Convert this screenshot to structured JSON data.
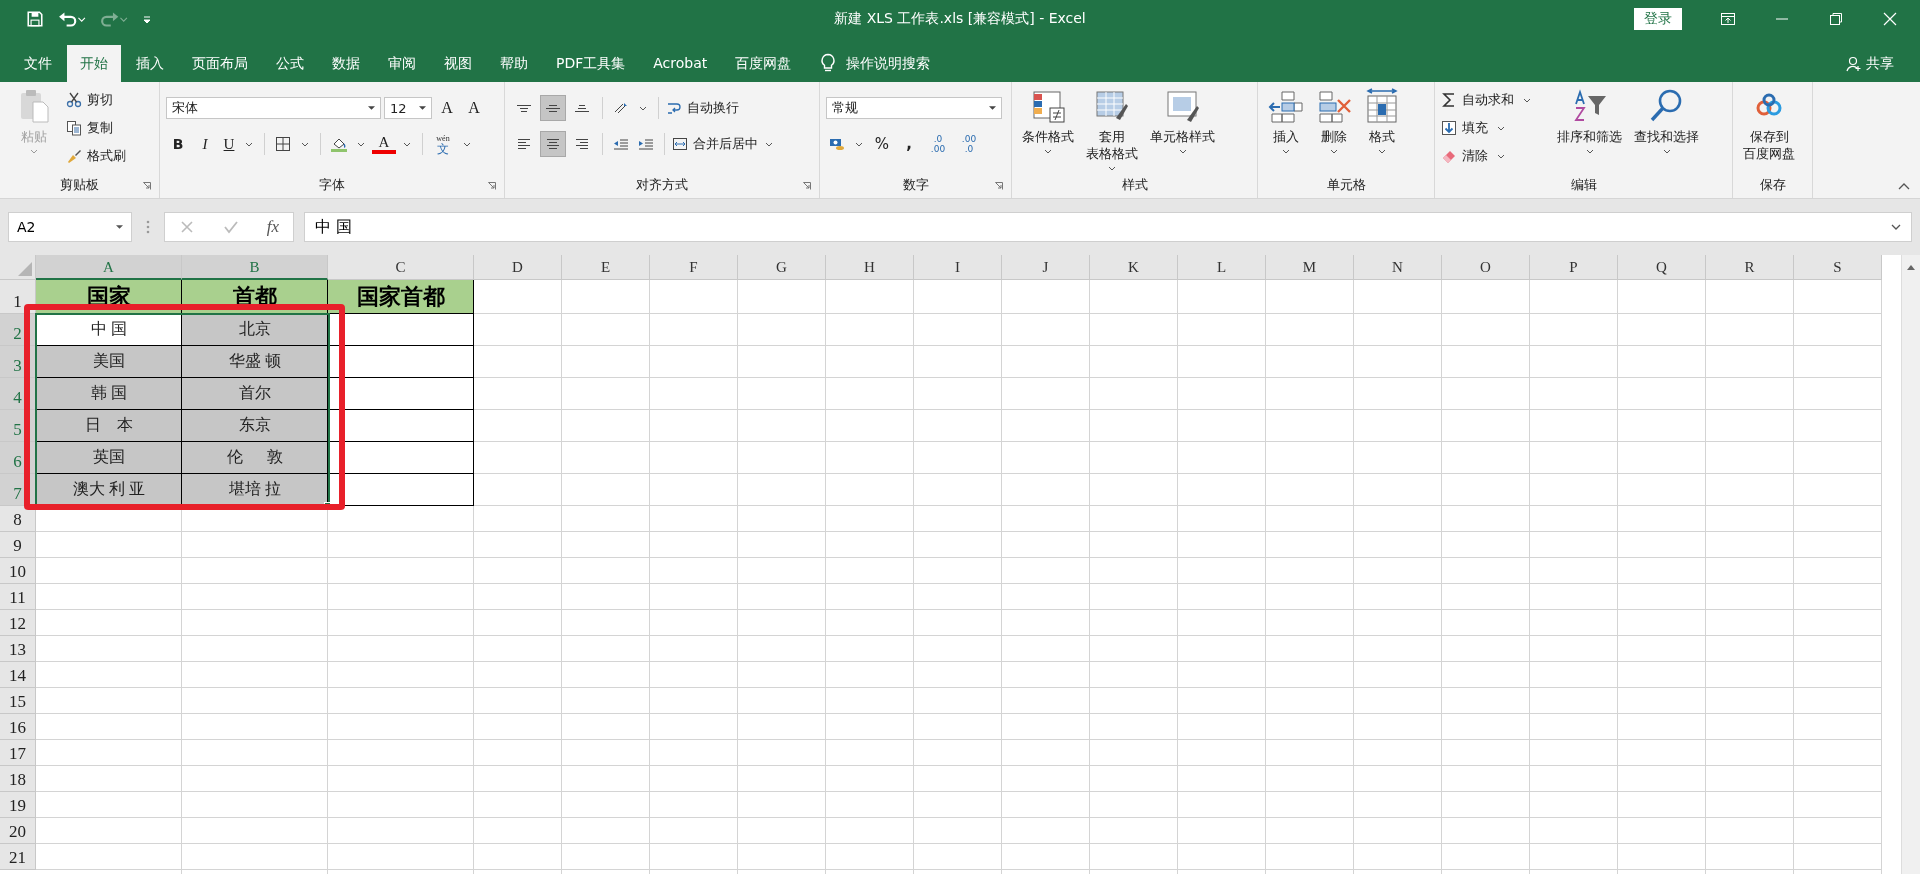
{
  "title_bar": {
    "title": "新建 XLS 工作表.xls  [兼容模式]  -  Excel",
    "login": "登录"
  },
  "tabs": [
    {
      "label": "文件",
      "selected": false
    },
    {
      "label": "开始",
      "selected": true
    },
    {
      "label": "插入",
      "selected": false
    },
    {
      "label": "页面布局",
      "selected": false
    },
    {
      "label": "公式",
      "selected": false
    },
    {
      "label": "数据",
      "selected": false
    },
    {
      "label": "审阅",
      "selected": false
    },
    {
      "label": "视图",
      "selected": false
    },
    {
      "label": "帮助",
      "selected": false
    },
    {
      "label": "PDF工具集",
      "selected": false
    },
    {
      "label": "Acrobat",
      "selected": false
    },
    {
      "label": "百度网盘",
      "selected": false
    }
  ],
  "tell_me": "操作说明搜索",
  "share": "共享",
  "clipboard": {
    "label": "剪贴板",
    "paste": {
      "label": "粘贴",
      "disabled": true
    },
    "items": [
      {
        "label": "剪切",
        "kind": "cut"
      },
      {
        "label": "复制",
        "kind": "copy"
      },
      {
        "label": "格式刷",
        "kind": "painter"
      }
    ]
  },
  "font": {
    "label": "字体",
    "name": "宋体",
    "size": "12",
    "grow": "A",
    "shrink": "A",
    "bold": "B",
    "italic": "I",
    "underline": "U",
    "color_letter": "A",
    "phonetic": "文",
    "phonetic_top": "wén"
  },
  "alignment": {
    "label": "对齐方式",
    "vertical": [
      {
        "kind": "top",
        "selected": false
      },
      {
        "kind": "middle",
        "selected": true
      },
      {
        "kind": "bottom",
        "selected": false
      }
    ],
    "horizontal": [
      {
        "kind": "left",
        "selected": false
      },
      {
        "kind": "center",
        "selected": true
      },
      {
        "kind": "right",
        "selected": false
      }
    ],
    "wrap": "自动换行",
    "merge": "合并后居中"
  },
  "number": {
    "label": "数字",
    "format": "常规",
    "percent": "%",
    "comma": ",",
    "decimals": [
      {
        "top": ".0",
        "bottom": ".00"
      },
      {
        "top": ".00",
        "bottom": ".0"
      }
    ]
  },
  "styles": {
    "label": "样式",
    "items": [
      {
        "lines": [
          "条件格式"
        ],
        "kind": "conditional"
      },
      {
        "lines": [
          "套用",
          "表格格式"
        ],
        "kind": "table"
      },
      {
        "lines": [
          "单元格样式"
        ],
        "kind": "cellstyle"
      }
    ]
  },
  "cells_group": {
    "label": "单元格",
    "items": [
      {
        "label": "插入",
        "kind": "insert"
      },
      {
        "label": "删除",
        "kind": "delete"
      },
      {
        "label": "格式",
        "kind": "format"
      }
    ]
  },
  "editing": {
    "label": "编辑",
    "small": [
      {
        "label": "自动求和",
        "kind": "sum"
      },
      {
        "label": "填充",
        "kind": "fill"
      },
      {
        "label": "清除",
        "kind": "clear"
      }
    ],
    "big": [
      {
        "label": "排序和筛选",
        "kind": "sort"
      },
      {
        "label": "查找和选择",
        "kind": "find"
      }
    ]
  },
  "save": {
    "label": "保存",
    "lines": [
      "保存到",
      "百度网盘"
    ]
  },
  "formula_bar": {
    "name_box": "A2",
    "fx": "fx",
    "value": "中 国"
  },
  "sheet": {
    "columns": [
      {
        "label": "A",
        "selected": true
      },
      {
        "label": "B",
        "selected": true
      },
      {
        "label": "C",
        "selected": false
      },
      {
        "label": "D",
        "selected": false
      },
      {
        "label": "E",
        "selected": false
      },
      {
        "label": "F",
        "selected": false
      },
      {
        "label": "G",
        "selected": false
      },
      {
        "label": "H",
        "selected": false
      },
      {
        "label": "I",
        "selected": false
      },
      {
        "label": "J",
        "selected": false
      },
      {
        "label": "K",
        "selected": false
      },
      {
        "label": "L",
        "selected": false
      },
      {
        "label": "M",
        "selected": false
      },
      {
        "label": "N",
        "selected": false
      },
      {
        "label": "O",
        "selected": false
      },
      {
        "label": "P",
        "selected": false
      },
      {
        "label": "Q",
        "selected": false
      },
      {
        "label": "R",
        "selected": false
      },
      {
        "label": "S",
        "selected": false
      }
    ],
    "rows": [
      {
        "label": "1",
        "selected": false,
        "cells": [
          {
            "kind": "header",
            "text": "国家"
          },
          {
            "kind": "header",
            "text": "首都"
          },
          {
            "kind": "header",
            "text": "国家首都"
          }
        ]
      },
      {
        "label": "2",
        "selected": true,
        "cells": [
          {
            "kind": "text",
            "text": "中 国",
            "active": true
          },
          {
            "kind": "text",
            "text": "北京",
            "active": false
          },
          {
            "kind": "empty"
          }
        ]
      },
      {
        "label": "3",
        "selected": true,
        "cells": [
          {
            "kind": "text",
            "text": "美国",
            "active": false
          },
          {
            "kind": "text",
            "text": "华盛 顿",
            "active": false
          },
          {
            "kind": "empty"
          }
        ]
      },
      {
        "label": "4",
        "selected": true,
        "cells": [
          {
            "kind": "text",
            "text": "韩 国",
            "active": false
          },
          {
            "kind": "text",
            "text": "首尔",
            "active": false
          },
          {
            "kind": "empty"
          }
        ]
      },
      {
        "label": "5",
        "selected": true,
        "cells": [
          {
            "kind": "text",
            "text": "日    本",
            "active": false
          },
          {
            "kind": "text",
            "text": "东京",
            "active": false
          },
          {
            "kind": "empty"
          }
        ]
      },
      {
        "label": "6",
        "selected": true,
        "cells": [
          {
            "kind": "text",
            "text": "英国",
            "active": false
          },
          {
            "kind": "text",
            "text": "伦      敦",
            "active": false
          },
          {
            "kind": "empty"
          }
        ]
      },
      {
        "label": "7",
        "selected": true,
        "cells": [
          {
            "kind": "text",
            "text": "澳大 利 亚",
            "active": false
          },
          {
            "kind": "text",
            "text": "堪培 拉",
            "active": false
          },
          {
            "kind": "empty"
          }
        ]
      },
      {
        "label": "8",
        "selected": false
      },
      {
        "label": "9",
        "selected": false
      },
      {
        "label": "10",
        "selected": false
      },
      {
        "label": "11",
        "selected": false
      },
      {
        "label": "12",
        "selected": false
      },
      {
        "label": "13",
        "selected": false
      },
      {
        "label": "14",
        "selected": false
      },
      {
        "label": "15",
        "selected": false
      },
      {
        "label": "16",
        "selected": false
      },
      {
        "label": "17",
        "selected": false
      },
      {
        "label": "18",
        "selected": false
      },
      {
        "label": "19",
        "selected": false
      },
      {
        "label": "20",
        "selected": false
      },
      {
        "label": "21",
        "selected": false
      }
    ]
  },
  "annotation": {
    "kind": "rectangle"
  }
}
